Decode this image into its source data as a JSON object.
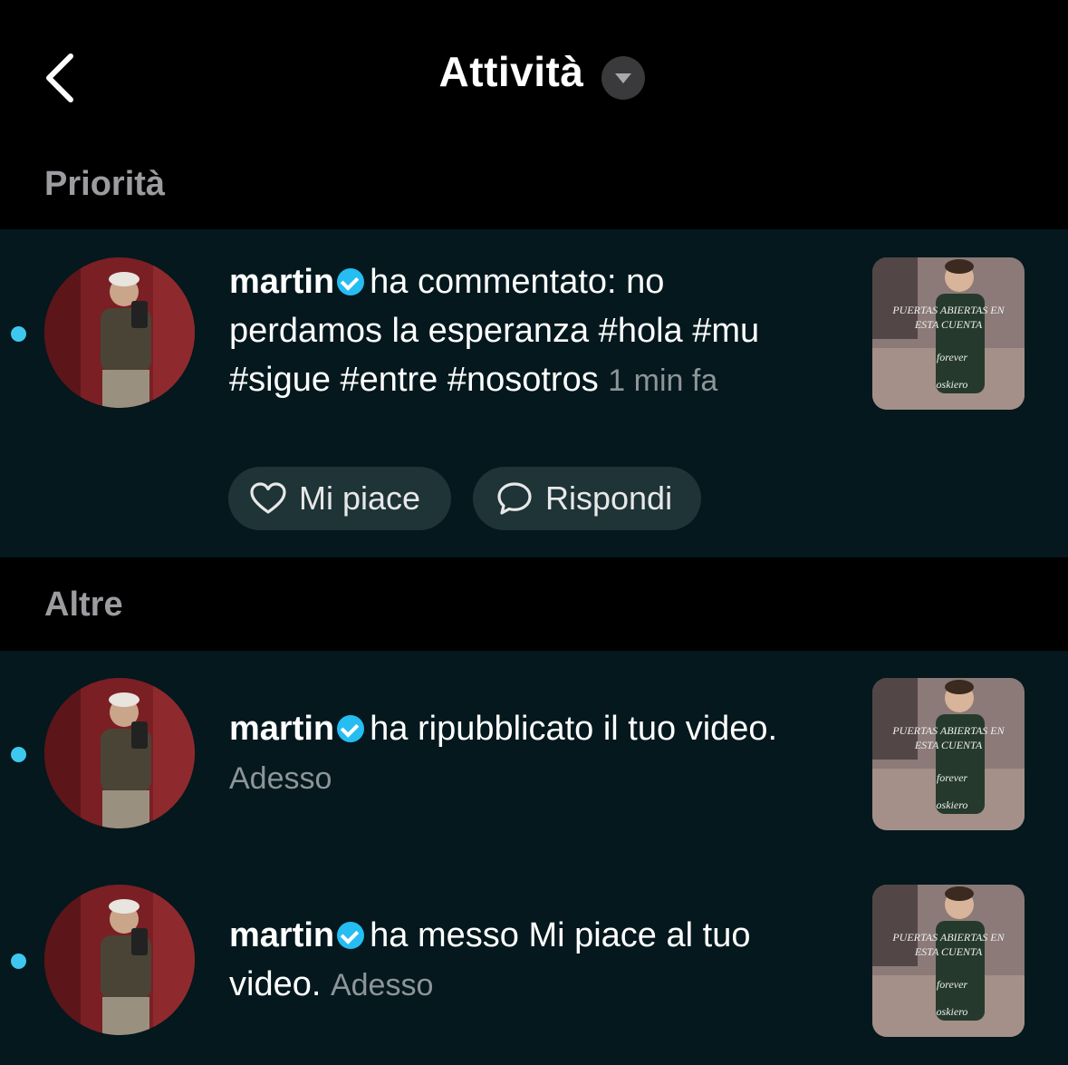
{
  "header": {
    "title": "Attività",
    "back_icon": "chevron-left-icon",
    "dropdown_icon": "caret-down-icon"
  },
  "sections": {
    "priority_label": "Priorità",
    "others_label": "Altre"
  },
  "priority_item": {
    "user": "martin",
    "action": "ha commentato: no perdamos la esperanza #hola #mu #sigue #entre #nosotros",
    "time": "1 min fa",
    "like_label": "Mi piace",
    "reply_label": "Rispondi",
    "unread": true
  },
  "other_items": [
    {
      "user": "martin",
      "action": "ha ripubblicato il tuo video.",
      "time": "Adesso",
      "unread": true
    },
    {
      "user": "martin",
      "action": "ha messo Mi piace al tuo video.",
      "time": "Adesso",
      "unread": true
    }
  ],
  "thumbnail_text": {
    "line1": "PUERTAS ABIERTAS EN",
    "line2": "ESTA CUENTA",
    "line3": "forever",
    "line4": "oskiero"
  },
  "colors": {
    "background": "#000000",
    "panel": "#04181d",
    "unread_dot": "#3fc8ef",
    "verified": "#25bdf2",
    "pill": "#1e3437"
  }
}
